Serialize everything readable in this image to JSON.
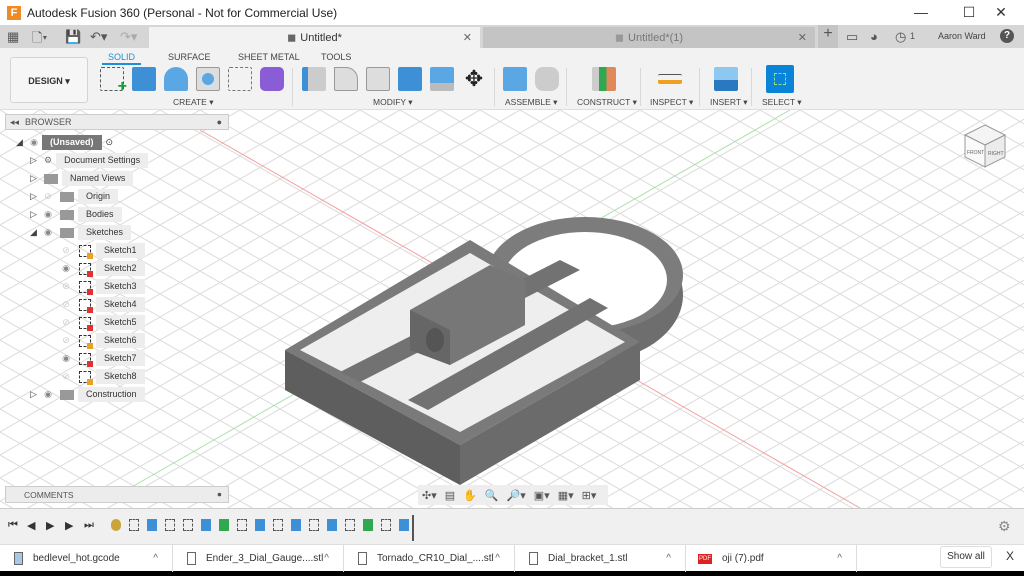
{
  "window": {
    "title": "Autodesk Fusion 360 (Personal - Not for Commercial Use)",
    "logo": "F",
    "minimize": "—",
    "maximize": "☐",
    "close": "✕"
  },
  "tabs": [
    {
      "label": "Untitled*",
      "active": true
    },
    {
      "label": "Untitled*(1)",
      "active": false
    }
  ],
  "header": {
    "user": "Aaron Ward",
    "jobs_count": "1",
    "help": "?",
    "new_tab": "+"
  },
  "toolbar": {
    "workspace": "DESIGN ▾",
    "tabs": [
      "SOLID",
      "SURFACE",
      "SHEET METAL",
      "TOOLS"
    ],
    "groups": [
      "CREATE ▾",
      "MODIFY ▾",
      "ASSEMBLE ▾",
      "CONSTRUCT ▾",
      "INSPECT ▾",
      "INSERT ▾",
      "SELECT ▾"
    ]
  },
  "browser": {
    "title": "BROWSER",
    "root": "(Unsaved)",
    "items": [
      {
        "label": "Document Settings",
        "icon": "gear-icon"
      },
      {
        "label": "Named Views",
        "icon": "folder-icon"
      },
      {
        "label": "Origin",
        "icon": "folder-icon",
        "visible": false
      },
      {
        "label": "Bodies",
        "icon": "folder-icon",
        "visible": true
      },
      {
        "label": "Sketches",
        "icon": "folder-icon",
        "visible": true,
        "expanded": true
      },
      {
        "label": "Construction",
        "icon": "folder-icon",
        "visible": true
      }
    ],
    "sketches": [
      {
        "label": "Sketch1",
        "visible": false,
        "type": "pencil"
      },
      {
        "label": "Sketch2",
        "visible": true,
        "type": "lock"
      },
      {
        "label": "Sketch3",
        "visible": false,
        "type": "lock"
      },
      {
        "label": "Sketch4",
        "visible": false,
        "type": "lock"
      },
      {
        "label": "Sketch5",
        "visible": false,
        "type": "lock"
      },
      {
        "label": "Sketch6",
        "visible": false,
        "type": "pencil"
      },
      {
        "label": "Sketch7",
        "visible": true,
        "type": "lock"
      },
      {
        "label": "Sketch8",
        "visible": false,
        "type": "pencil"
      }
    ]
  },
  "comments": {
    "title": "COMMENTS"
  },
  "viewcube": {
    "front": "FRONT",
    "right": "RIGHT"
  },
  "timeline": {
    "controls": [
      "⏮",
      "◀",
      "▶",
      "▶",
      "⏭"
    ],
    "features": [
      "component",
      "sketch",
      "extrude",
      "sketch",
      "sketch",
      "extrude",
      "plane",
      "sketch",
      "extrude",
      "sketch",
      "extrude",
      "sketch",
      "extrude",
      "sketch",
      "plane",
      "sketch",
      "extrude"
    ]
  },
  "downloads": {
    "files": [
      "bedlevel_hot.gcode",
      "Ender_3_Dial_Gauge....stl",
      "Tornado_CR10_Dial_....stl",
      "Dial_bracket_1.stl",
      "oji (7).pdf"
    ],
    "show_all": "Show all",
    "close": "X"
  },
  "colors": {
    "accent": "#1d8fd6",
    "body": "#6b6b6b",
    "grid": "#d9d9d9"
  }
}
